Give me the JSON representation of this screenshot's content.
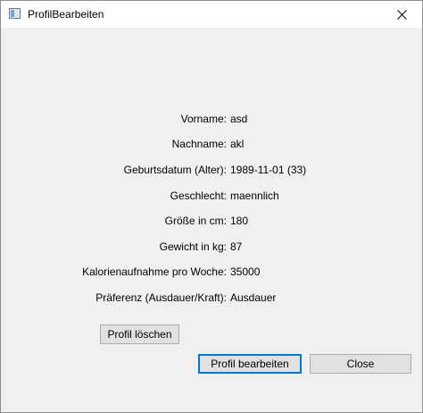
{
  "window": {
    "title": "ProfilBearbeiten"
  },
  "profile": [
    {
      "label": "Vorname:",
      "value": "asd"
    },
    {
      "label": "Nachname:",
      "value": "akl"
    },
    {
      "label": "Geburtsdatum (Alter):",
      "value": "1989-11-01 (33)"
    },
    {
      "label": "Geschlecht:",
      "value": "maennlich"
    },
    {
      "label": "Größe in cm:",
      "value": "180"
    },
    {
      "label": "Gewicht in kg:",
      "value": "87"
    },
    {
      "label": "Kalorienaufnahme pro Woche:",
      "value": "35000"
    },
    {
      "label": "Präferenz (Ausdauer/Kraft):",
      "value": "Ausdauer"
    }
  ],
  "buttons": {
    "delete": "Profil löschen",
    "edit": "Profil bearbeiten",
    "close": "Close"
  },
  "icons": {
    "app": "window-app-icon",
    "close": "close-icon"
  }
}
